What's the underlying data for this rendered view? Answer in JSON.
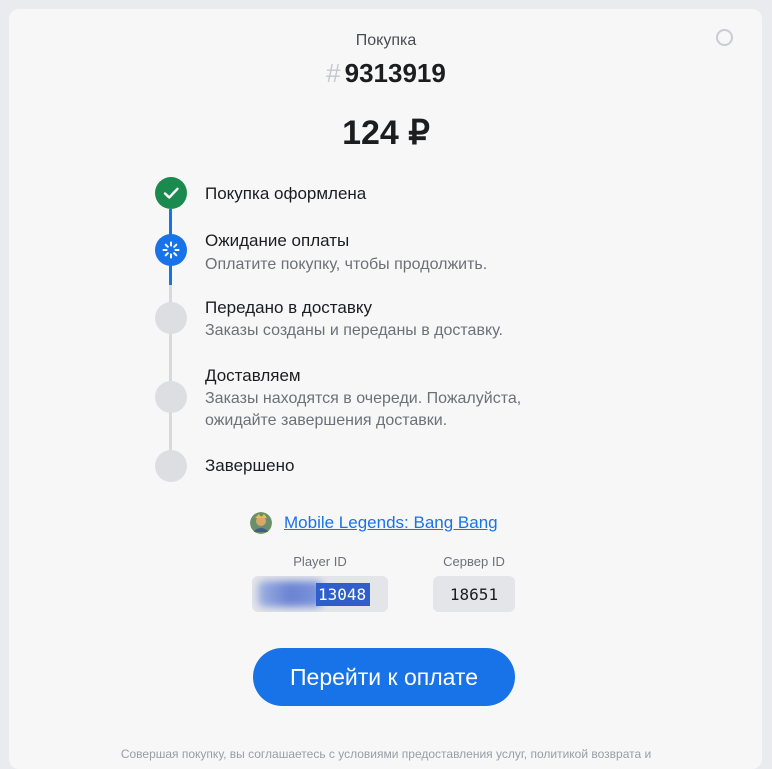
{
  "header": {
    "title": "Покупка",
    "order_hash": "#",
    "order_number": "9313919",
    "amount": "124 ₽"
  },
  "steps": [
    {
      "title": "Покупка оформлена",
      "desc": "",
      "status": "done"
    },
    {
      "title": "Ожидание оплаты",
      "desc": "Оплатите покупку, чтобы продолжить.",
      "status": "active"
    },
    {
      "title": "Передано в доставку",
      "desc": "Заказы созданы и переданы в доставку.",
      "status": "pending"
    },
    {
      "title": "Доставляем",
      "desc": "Заказы находятся в очереди. Пожалуйста, ожидайте завершения доставки.",
      "status": "pending"
    },
    {
      "title": "Завершено",
      "desc": "",
      "status": "pending"
    }
  ],
  "game": {
    "name": "Mobile Legends: Bang Bang",
    "icon": "game-avatar-icon"
  },
  "fields": {
    "player_id_label": "Player ID",
    "player_id_value": "13048",
    "server_id_label": "Сервер ID",
    "server_id_value": "18651"
  },
  "pay_button": "Перейти к оплате",
  "footer_text": "Совершая покупку, вы соглашаетесь с условиями предоставления услуг, политикой возврата и",
  "colors": {
    "accent": "#1973e8",
    "done": "#1b8a4f",
    "pending": "#dcdee2",
    "card": "#f7f7f8"
  }
}
